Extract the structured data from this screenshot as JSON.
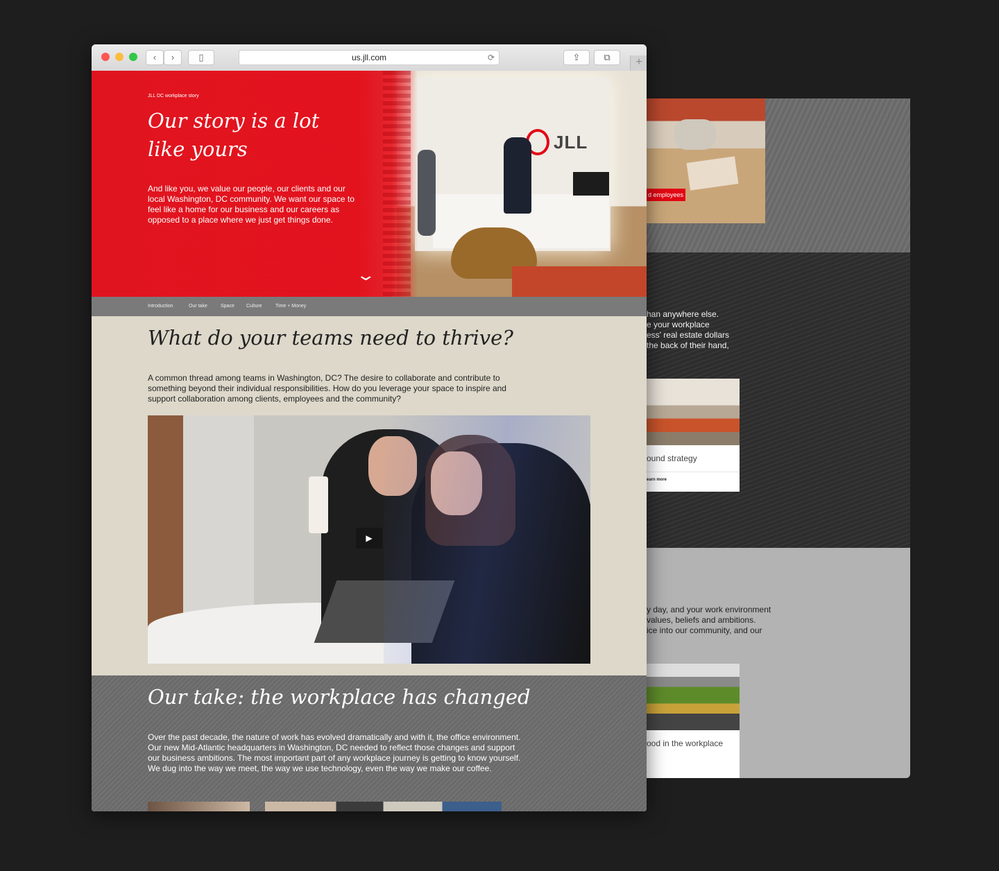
{
  "browser": {
    "url": "us.jll.com",
    "reload_icon": "⟳",
    "newtab_icon": "+"
  },
  "hero": {
    "label": "JLL DC workplace story",
    "title": "Our story is a lot like yours",
    "body": "And like you, we value our people, our clients and our local Washington, DC community. We want our space to feel like a home for our business and our careers as opposed to a place where we just get things done.",
    "logo_text": "JLL",
    "chevron": "⌄"
  },
  "nav": {
    "items": [
      "Introduction",
      "Our take",
      "Space",
      "Culture",
      "Time + Money"
    ]
  },
  "section1": {
    "title": "What do your teams need to thrive?",
    "body": "A common thread among teams in Washington, DC? The desire to collaborate and contribute to something beyond their individual responsibilities. How do you leverage your space to inspire and support collaboration among clients, employees and the community?",
    "play_icon": "▶"
  },
  "section2": {
    "title": "Our take: the workplace has changed",
    "body": "Over the past decade, the nature of work has evolved dramatically and with it, the office environment. Our new Mid-Atlantic headquarters in Washington, DC needed to reflect those changes and support our business ambitions. The most important part of any workplace journey is getting to know yourself. We dug into the way we meet, the way we use technology, even the way we make our coffee."
  },
  "back_page": {
    "badge": "d employees",
    "s2_lines": [
      "han anywhere else.",
      "e your workplace",
      "ess' real estate dollars",
      "the back of their hand,"
    ],
    "card1_caption": "ound strategy",
    "card1_more": "earn more",
    "s3_lines": [
      "y day, and your work environment",
      "values, beliefs and ambitions.",
      "ice into our community, and our"
    ],
    "card2_caption": "ood in the workplace"
  },
  "colors": {
    "brand_red": "#e3131e",
    "nav_gray": "#7a7a7a",
    "beige": "#ddd8ca",
    "slate": "#6e6e6e",
    "background": "#1e1e1e"
  }
}
